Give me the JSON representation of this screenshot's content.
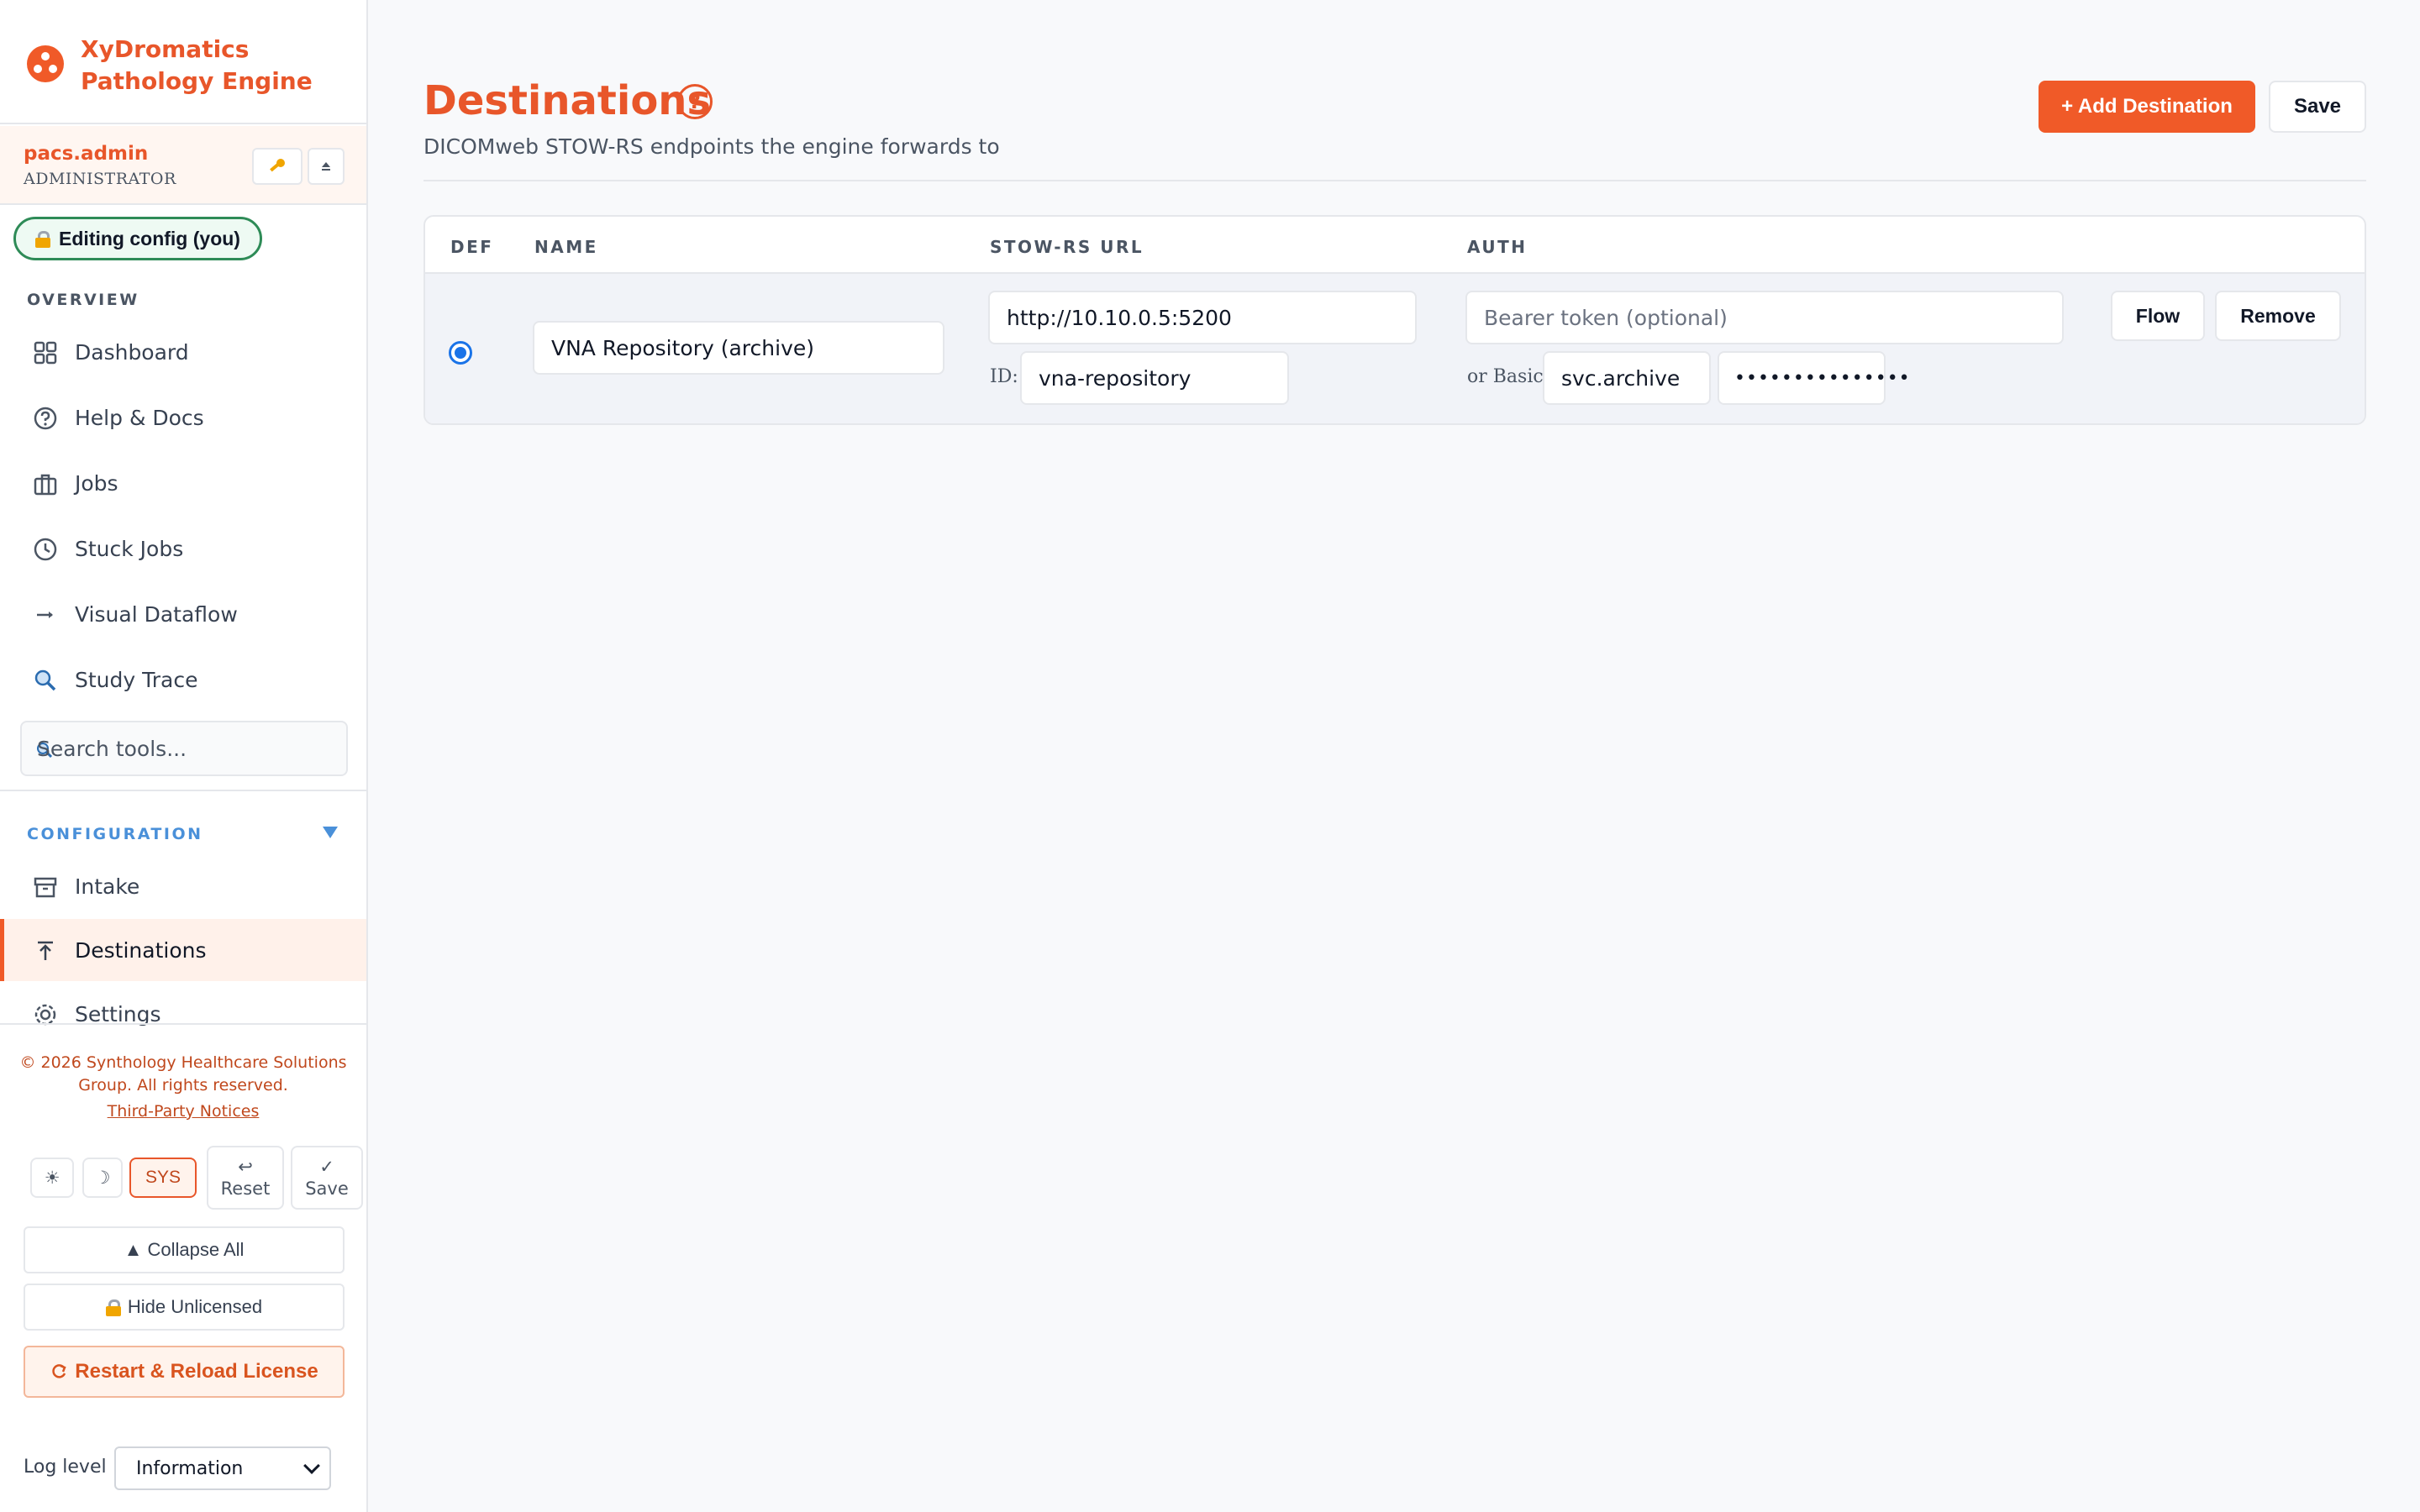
{
  "app": {
    "brand_line1": "XyDromatics",
    "brand_line2": "Pathology Engine",
    "brand_color": "#f05a28"
  },
  "user": {
    "name": "pacs.admin",
    "role": "ADMINISTRATOR",
    "key_icon": "key-icon",
    "eject_icon": "eject-icon"
  },
  "edit_badge": "Editing config (you)",
  "sidebar": {
    "overview_label": "OVERVIEW",
    "overview_items": [
      {
        "label": "Dashboard",
        "icon": "grid-icon"
      },
      {
        "label": "Help & Docs",
        "icon": "help-icon"
      },
      {
        "label": "Jobs",
        "icon": "briefcase-icon"
      },
      {
        "label": "Stuck Jobs",
        "icon": "clock-icon"
      },
      {
        "label": "Visual Dataflow",
        "icon": "arrow-right-icon"
      },
      {
        "label": "Study Trace",
        "icon": "magnifier-icon"
      }
    ],
    "search_placeholder": "Search tools...",
    "configuration_label": "CONFIGURATION",
    "config_items": [
      {
        "label": "Intake",
        "icon": "archive-box-icon"
      },
      {
        "label": "Destinations",
        "icon": "upload-icon",
        "active": true
      },
      {
        "label": "Settings",
        "icon": "gear-icon"
      }
    ],
    "copyright": "© 2026 Synthology Healthcare Solutions Group. All rights reserved.",
    "third_party": "Third-Party Notices",
    "theme": {
      "light_glyph": "☀",
      "dark_glyph": "☽",
      "sys_label": "SYS"
    },
    "reset": {
      "glyph": "↩",
      "label": "Reset"
    },
    "save": {
      "glyph": "✓",
      "label": "Save"
    },
    "collapse_all": "▲ Collapse All",
    "hide_unlicensed": "Hide Unlicensed",
    "restart": "Restart & Reload License",
    "log_level_label": "Log level",
    "log_level_value": "Information"
  },
  "page": {
    "title": "Destinations",
    "help_glyph": "?",
    "subtitle": "DICOMweb STOW-RS endpoints the engine forwards to",
    "add_button": "+ Add Destination",
    "save_button": "Save"
  },
  "table": {
    "headers": {
      "def": "DEF",
      "name": "NAME",
      "url": "STOW-RS URL",
      "auth": "AUTH"
    },
    "rows": [
      {
        "default": true,
        "name": "VNA Repository (archive)",
        "url": "http://10.10.0.5:5200",
        "id_label": "ID:",
        "id": "vna-repository",
        "bearer_placeholder": "Bearer token (optional)",
        "basic_label": "or Basic:",
        "basic_user": "svc.archive",
        "basic_password_masked": "•••••••••••••••",
        "flow_button": "Flow",
        "remove_button": "Remove"
      }
    ]
  }
}
